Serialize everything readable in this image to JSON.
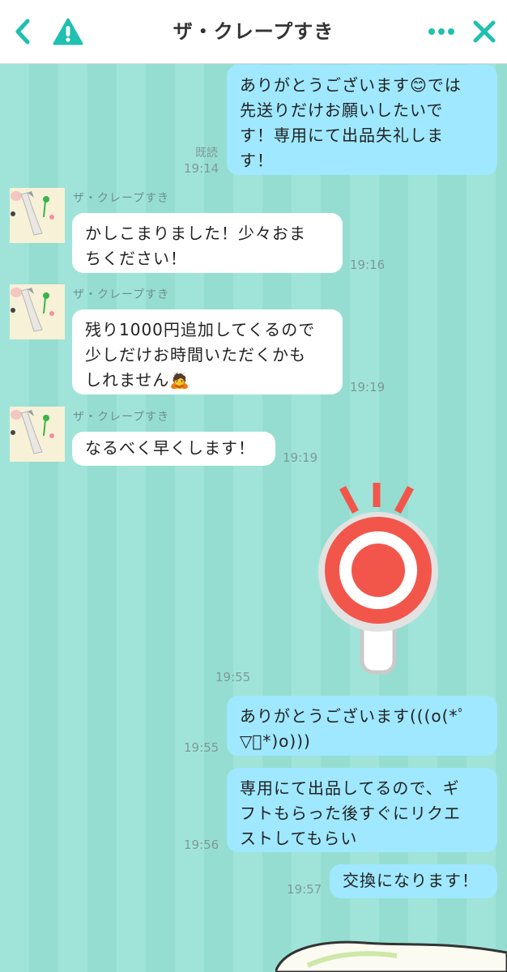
{
  "header": {
    "title": "ザ・クレープすき",
    "back_icon": "chevron-left-icon",
    "report_icon": "warning-icon",
    "more_icon": "more-horizontal-icon",
    "close_icon": "close-icon"
  },
  "colors": {
    "accent": "#1fc0b0",
    "chat_background": "#9ee3d8",
    "my_bubble": "#9fe8ff",
    "their_bubble": "#ffffff",
    "stamp_red": "#f2564b"
  },
  "messages": [
    {
      "from": "me",
      "text": "ありがとうございます😊では\n先送りだけお願いしたいで\nす！専用にて出品失礼しま\nす！",
      "time": "19:14",
      "read": "既読"
    },
    {
      "from": "them",
      "sender": "ザ・クレープすき",
      "text": "かしこまりました！少々おま\nちください！",
      "time": "19:16"
    },
    {
      "from": "them",
      "sender": "ザ・クレープすき",
      "text": "残り1000円追加してくるので\n少しだけお時間いただくかも\nしれません🙇",
      "time": "19:19"
    },
    {
      "from": "them",
      "sender": "ザ・クレープすき",
      "text": "なるべく早くします！",
      "time": "19:19"
    },
    {
      "from": "me",
      "type": "stamp",
      "stamp": "maru-sign-stamp",
      "time": "19:55"
    },
    {
      "from": "me",
      "text": "ありがとうございます(((o(*ﾟ\n▽ﾟ*)o)))",
      "time": "19:55"
    },
    {
      "from": "me",
      "text": "専用にて出品してるので、ギ\nフトもらった後すぐにリクエ\nストしてもらい",
      "time": "19:56"
    },
    {
      "from": "me",
      "text": "交換になります！",
      "time": "19:57"
    }
  ]
}
